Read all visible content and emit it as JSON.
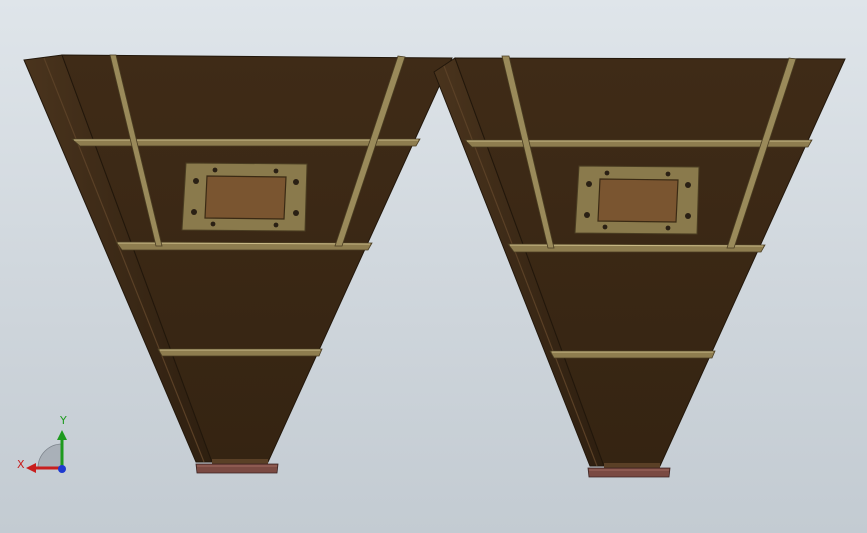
{
  "viewport": {
    "background_top": "#dfe5ea",
    "background_bottom": "#c3cbd2"
  },
  "model": {
    "parts": [
      "hopper-left",
      "hopper-right"
    ],
    "colors": {
      "body": "#3d2a17",
      "body_dark": "#2c1e10",
      "panel_edge": "#5a4026",
      "stiffener": "#9a8a5a",
      "stiffener_highlight": "#c9b886",
      "door_frame": "#8a7a4c",
      "door_window": "#7a5530",
      "outlet_flange": "#7a4a42",
      "bolt": "#2a2014"
    }
  },
  "triad": {
    "y_label": "Y",
    "x_label": "X",
    "y_color": "#1e9a1e",
    "x_color": "#c81e1e",
    "z_color": "#1e3ad0"
  }
}
